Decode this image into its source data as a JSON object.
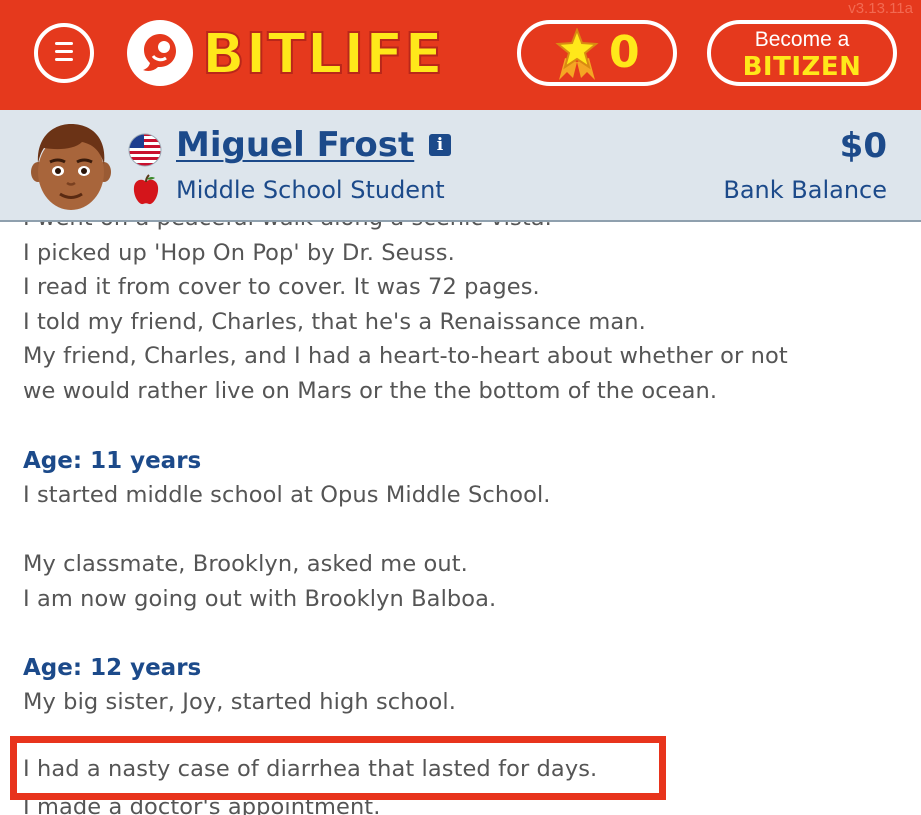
{
  "app": {
    "version": "v3.13.11a",
    "logo_text": "BITLIFE",
    "ribbon_count": "0",
    "become_label": "Become a",
    "bitizen_label": "BITIZEN",
    "brand_red": "#e5391d",
    "brand_yellow": "#ffe81a"
  },
  "profile": {
    "name": "Miguel Frost",
    "occupation": "Middle School Student",
    "balance": "$0",
    "balance_label": "Bank Balance",
    "flag_icon": "us-flag-icon",
    "occupation_icon": "apple-icon",
    "text_color": "#1c4a8a"
  },
  "log": {
    "cut_top_line": "I went on a peaceful walk along a scenic vista.",
    "entries_before": [
      "I picked up 'Hop On Pop' by Dr. Seuss.",
      "I read it from cover to cover. It was 72 pages.",
      "I told my friend, Charles, that he's a Renaissance man.",
      "My friend, Charles, and I had a heart-to-heart about whether or not",
      "we would rather live on Mars or the the bottom of the ocean."
    ],
    "age11": {
      "heading": "Age: 11 years",
      "lines": [
        "I started middle school at Opus Middle School.",
        "My classmate, Brooklyn, asked me out.",
        "I am now going out with Brooklyn Balboa."
      ]
    },
    "age12": {
      "heading": "Age: 12 years",
      "lines": [
        "My big sister, Joy, started high school.",
        "I had a nasty case of diarrhea that lasted for days.",
        "I made a doctor's appointment."
      ]
    },
    "highlight_color": "#e8341c"
  }
}
